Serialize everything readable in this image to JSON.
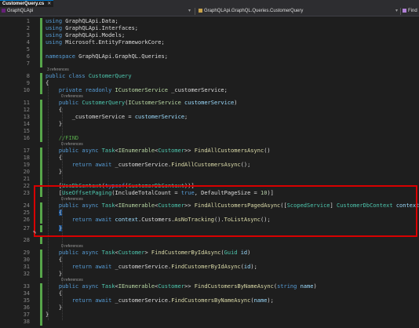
{
  "tab": {
    "title": "CustomerQuery.cs",
    "close": "✕"
  },
  "navbar": {
    "project": "GraphQLApi",
    "type": "GraphQLApi.GraphQL.Queries.CustomerQuery",
    "member": "Find"
  },
  "editor": {
    "lines": {
      "l1": "1",
      "l2": "2",
      "l3": "3",
      "l4": "4",
      "l5": "5",
      "l6": "6",
      "l7": "7",
      "l8": "8",
      "l9": "9",
      "l10": "10",
      "l11": "11",
      "l12": "12",
      "l13": "13",
      "l14": "14",
      "l15": "15",
      "l16": "16",
      "l17": "17",
      "l18": "18",
      "l19": "19",
      "l20": "20",
      "l21": "21",
      "l22": "22",
      "l23": "23",
      "l24": "24",
      "l25": "25",
      "l26": "26",
      "l27": "27",
      "l28": "28",
      "l29": "29",
      "l30": "30",
      "l31": "31",
      "l32": "32",
      "l33": "33",
      "l34": "34",
      "l35": "35",
      "l36": "36",
      "l37": "37",
      "l38": "38"
    },
    "refs": {
      "class": "3 references",
      "r0": "0 references",
      "r1": "0 references",
      "r2": "0 references",
      "r3": "0 references",
      "r4": "0 references",
      "r5": "0 references",
      "r6": "0 references"
    },
    "code": {
      "using": "using",
      "data_ns": "GraphQLApi.Data;",
      "interfaces_ns": "GraphQLApi.Interfaces;",
      "models_ns": "GraphQLApi.Models;",
      "efcore_ns": "Microsoft.EntityFrameworkCore;",
      "namespace_kw": "namespace",
      "namespace_name": "GraphQLApi.GraphQL.Queries;",
      "public": "public",
      "private": "private",
      "readonly": "readonly",
      "class": "class",
      "async": "async",
      "return": "return",
      "await": "await",
      "typeof": "typeof",
      "true": "true",
      "string": "string",
      "class_name": "CustomerQuery",
      "icustomer_service": "ICustomerService",
      "field_customer_service": "_customerService",
      "param_customer_service": "customerService",
      "comment_find": "//FIND",
      "task": "Task",
      "ienumerable": "IEnumerable",
      "customer": "Customer",
      "find_all": "FindAllCustomersAsync",
      "find_all_paged": "FindAllCustomersPagedAsync",
      "find_by_id": "FindCustomerByIdAsync",
      "find_by_name": "FindCustomersByNameAsync",
      "use_dbcontext": "UseDbContext",
      "use_offset_paging": "UseOffsetPaging",
      "include_total_count": "IncludeTotalCount",
      "default_page_size": "DefaultPageSize",
      "page_size_value": "10",
      "scoped_service": "ScopedService",
      "customer_db_context": "CustomerDbContext",
      "context": "context",
      "customers": "Customers",
      "as_no_tracking": "AsNoTracking",
      "to_list_async": "ToListAsync",
      "guid": "Guid",
      "id": "id",
      "name": "name"
    }
  },
  "colors": {
    "highlight_box": "#d80000",
    "change_bar": "#57a64a",
    "keyword": "#569cd6",
    "type": "#4ec9b0",
    "method": "#dcdcaa",
    "parameter": "#9cdcfe",
    "comment": "#57a64a"
  }
}
